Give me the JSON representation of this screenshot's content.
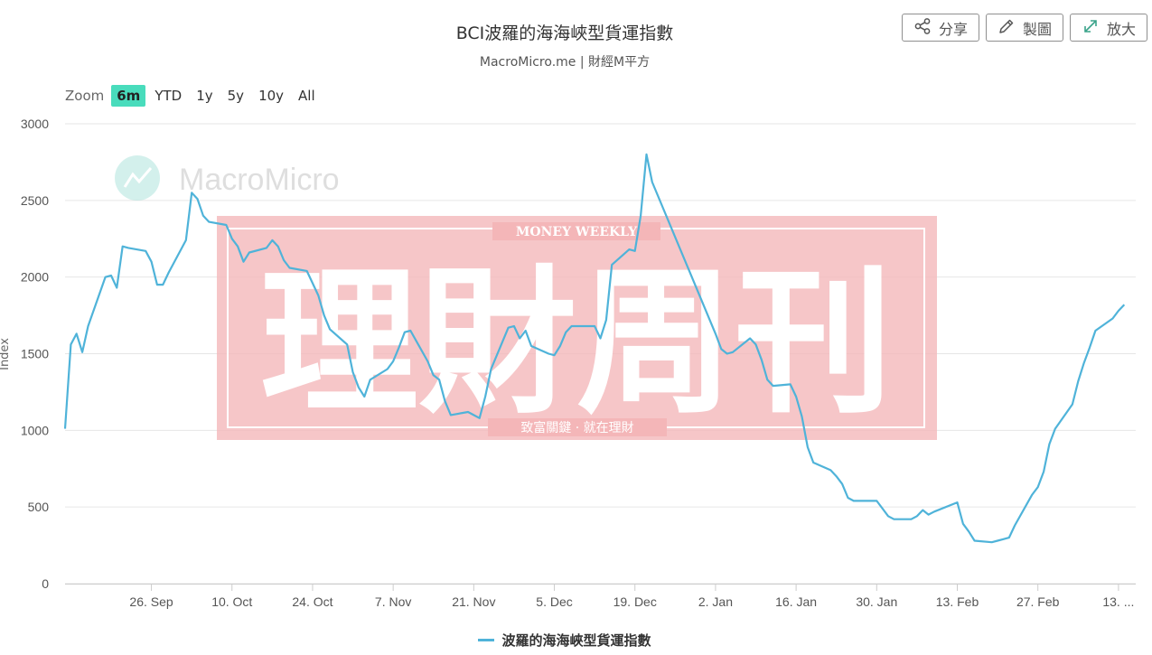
{
  "header": {
    "title": "BCI波羅的海海峽型貨運指數",
    "subtitle": "MacroMicro.me | 財經M平方"
  },
  "toolbar": {
    "share_label": "分享",
    "draw_label": "製圖",
    "enlarge_label": "放大"
  },
  "zoom": {
    "label": "Zoom",
    "options": [
      "6m",
      "YTD",
      "1y",
      "5y",
      "10y",
      "All"
    ],
    "selected": "6m"
  },
  "watermarks": {
    "macromicro_text": "MacroMicro",
    "stamp_main": "理財周刊",
    "stamp_top": "MONEY WEEKLY",
    "stamp_bottom": "致富關鍵 · 就在理財"
  },
  "colors": {
    "series_line": "#4fb3d9",
    "zoom_active": "#49dcbc",
    "stamp_fill": "#f4b6b8",
    "logo_tint": "#9fe0d6"
  },
  "chart_data": {
    "type": "line",
    "title": "BCI波羅的海海峽型貨運指數",
    "ylabel": "Index",
    "ylim": [
      0,
      3000
    ],
    "y_ticks": [
      0,
      500,
      1000,
      1500,
      2000,
      2500,
      3000
    ],
    "x_ticks": [
      "26. Sep",
      "10. Oct",
      "24. Oct",
      "7. Nov",
      "21. Nov",
      "5. Dec",
      "19. Dec",
      "2. Jan",
      "16. Jan",
      "30. Jan",
      "13. Feb",
      "27. Feb",
      "13. ..."
    ],
    "grid": true,
    "legend_position": "bottom-center",
    "series": [
      {
        "name": "波羅的海海峽型貨運指數",
        "x": [
          "2023-09-11",
          "2023-09-12",
          "2023-09-13",
          "2023-09-14",
          "2023-09-15",
          "2023-09-18",
          "2023-09-19",
          "2023-09-20",
          "2023-09-21",
          "2023-09-22",
          "2023-09-25",
          "2023-09-26",
          "2023-09-27",
          "2023-09-28",
          "2023-09-29",
          "2023-10-02",
          "2023-10-03",
          "2023-10-04",
          "2023-10-05",
          "2023-10-06",
          "2023-10-09",
          "2023-10-10",
          "2023-10-11",
          "2023-10-12",
          "2023-10-13",
          "2023-10-16",
          "2023-10-17",
          "2023-10-18",
          "2023-10-19",
          "2023-10-20",
          "2023-10-23",
          "2023-10-24",
          "2023-10-25",
          "2023-10-26",
          "2023-10-27",
          "2023-10-30",
          "2023-10-31",
          "2023-11-01",
          "2023-11-02",
          "2023-11-03",
          "2023-11-06",
          "2023-11-07",
          "2023-11-08",
          "2023-11-09",
          "2023-11-10",
          "2023-11-13",
          "2023-11-14",
          "2023-11-15",
          "2023-11-16",
          "2023-11-17",
          "2023-11-20",
          "2023-11-21",
          "2023-11-22",
          "2023-11-23",
          "2023-11-24",
          "2023-11-27",
          "2023-11-28",
          "2023-11-29",
          "2023-11-30",
          "2023-12-01",
          "2023-12-04",
          "2023-12-05",
          "2023-12-06",
          "2023-12-07",
          "2023-12-08",
          "2023-12-11",
          "2023-12-12",
          "2023-12-13",
          "2023-12-14",
          "2023-12-15",
          "2023-12-18",
          "2023-12-19",
          "2023-12-20",
          "2023-12-21",
          "2023-12-22",
          "2024-01-02",
          "2024-01-03",
          "2024-01-04",
          "2024-01-05",
          "2024-01-08",
          "2024-01-09",
          "2024-01-10",
          "2024-01-11",
          "2024-01-12",
          "2024-01-15",
          "2024-01-16",
          "2024-01-17",
          "2024-01-18",
          "2024-01-19",
          "2024-01-22",
          "2024-01-23",
          "2024-01-24",
          "2024-01-25",
          "2024-01-26",
          "2024-01-29",
          "2024-01-30",
          "2024-01-31",
          "2024-02-01",
          "2024-02-02",
          "2024-02-05",
          "2024-02-06",
          "2024-02-07",
          "2024-02-08",
          "2024-02-09",
          "2024-02-13",
          "2024-02-14",
          "2024-02-15",
          "2024-02-16",
          "2024-02-19",
          "2024-02-20",
          "2024-02-21",
          "2024-02-22",
          "2024-02-23",
          "2024-02-26",
          "2024-02-27",
          "2024-02-28",
          "2024-02-29",
          "2024-03-01",
          "2024-03-04",
          "2024-03-05",
          "2024-03-06",
          "2024-03-07",
          "2024-03-08",
          "2024-03-11",
          "2024-03-12",
          "2024-03-13"
        ],
        "values": [
          1010,
          1560,
          1630,
          1510,
          1680,
          2000,
          2010,
          1930,
          2200,
          2190,
          2170,
          2100,
          1950,
          1950,
          2030,
          2240,
          2550,
          2510,
          2400,
          2360,
          2340,
          2250,
          2200,
          2100,
          2160,
          2190,
          2240,
          2200,
          2110,
          2060,
          2040,
          1960,
          1880,
          1750,
          1660,
          1560,
          1380,
          1280,
          1220,
          1330,
          1400,
          1450,
          1540,
          1640,
          1650,
          1450,
          1360,
          1330,
          1190,
          1100,
          1120,
          1100,
          1080,
          1220,
          1400,
          1670,
          1680,
          1600,
          1650,
          1550,
          1500,
          1490,
          1550,
          1640,
          1680,
          1680,
          1680,
          1600,
          1720,
          2080,
          2180,
          2170,
          2400,
          2800,
          2620,
          1630,
          1530,
          1500,
          1510,
          1600,
          1560,
          1460,
          1330,
          1290,
          1300,
          1220,
          1090,
          890,
          790,
          740,
          700,
          650,
          560,
          540,
          540,
          540,
          490,
          440,
          420,
          420,
          440,
          480,
          450,
          470,
          530,
          390,
          340,
          280,
          270,
          280,
          290,
          300,
          380,
          580,
          630,
          730,
          910,
          1010,
          1170,
          1320,
          1440,
          1540,
          1650,
          1730,
          1780,
          1820
        ]
      }
    ]
  }
}
